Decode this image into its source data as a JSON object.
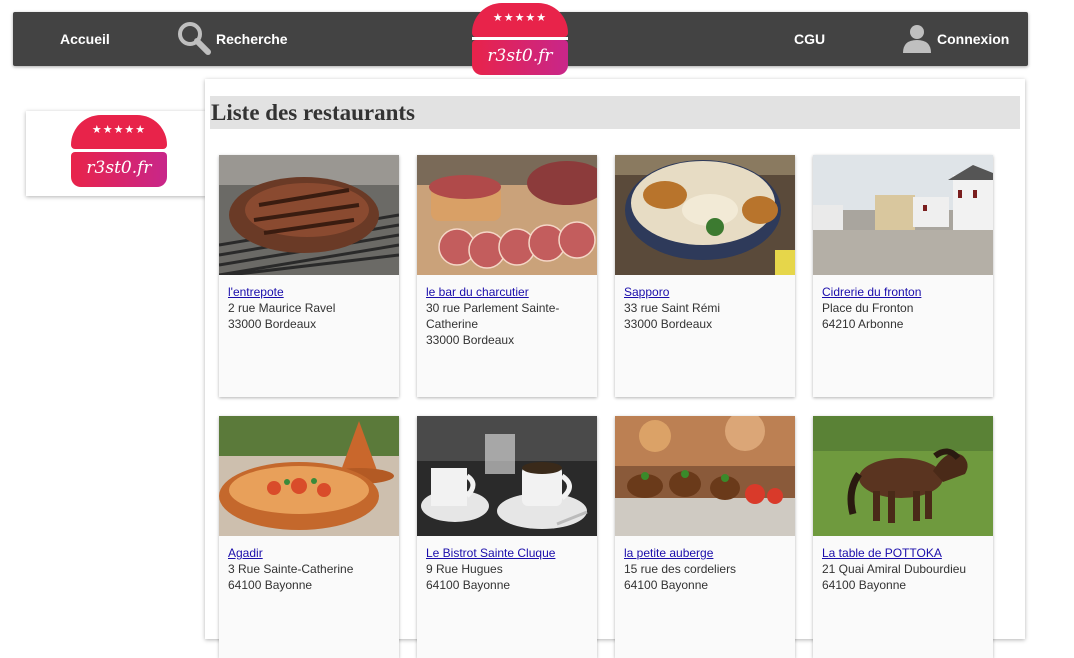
{
  "nav": {
    "home": "Accueil",
    "search": "Recherche",
    "cgu": "CGU",
    "login": "Connexion"
  },
  "logo": {
    "text": "r3st0.fr",
    "stars": "★★★★★"
  },
  "icons": {
    "search": "search-icon",
    "user": "user-icon"
  },
  "colors": {
    "navbar": "#434343",
    "logo_red": "#e8234a",
    "logo_magenta": "#c8268a",
    "link": "#1a0dab"
  },
  "page": {
    "title": "Liste des restaurants"
  },
  "restaurants": [
    {
      "name": "l'entrepote",
      "address1": "2 rue Maurice Ravel",
      "address2": "33000 Bordeaux",
      "photo": "grilled steak"
    },
    {
      "name": "le bar du charcutier",
      "address1": "30 rue Parlement Sainte-Catherine",
      "address2": "33000 Bordeaux",
      "photo": "charcuterie"
    },
    {
      "name": "Sapporo",
      "address1": "33 rue Saint Rémi",
      "address2": "33000 Bordeaux",
      "photo": "ramen bowl"
    },
    {
      "name": "Cidrerie du fronton",
      "address1": "Place du Fronton",
      "address2": "64210 Arbonne",
      "photo": "fronton square"
    },
    {
      "name": "Agadir",
      "address1": "3 Rue Sainte-Catherine",
      "address2": "64100 Bayonne",
      "photo": "tajine"
    },
    {
      "name": "Le Bistrot Sainte Cluque",
      "address1": "9 Rue Hugues",
      "address2": "64100 Bayonne",
      "photo": "coffee cups"
    },
    {
      "name": "la petite auberge",
      "address1": "15 rue des cordeliers",
      "address2": "64100 Bayonne",
      "photo": "tapas plate"
    },
    {
      "name": "La table de POTTOKA",
      "address1": "21 Quai Amiral Dubourdieu",
      "address2": "64100 Bayonne",
      "photo": "pottoka pony"
    }
  ]
}
